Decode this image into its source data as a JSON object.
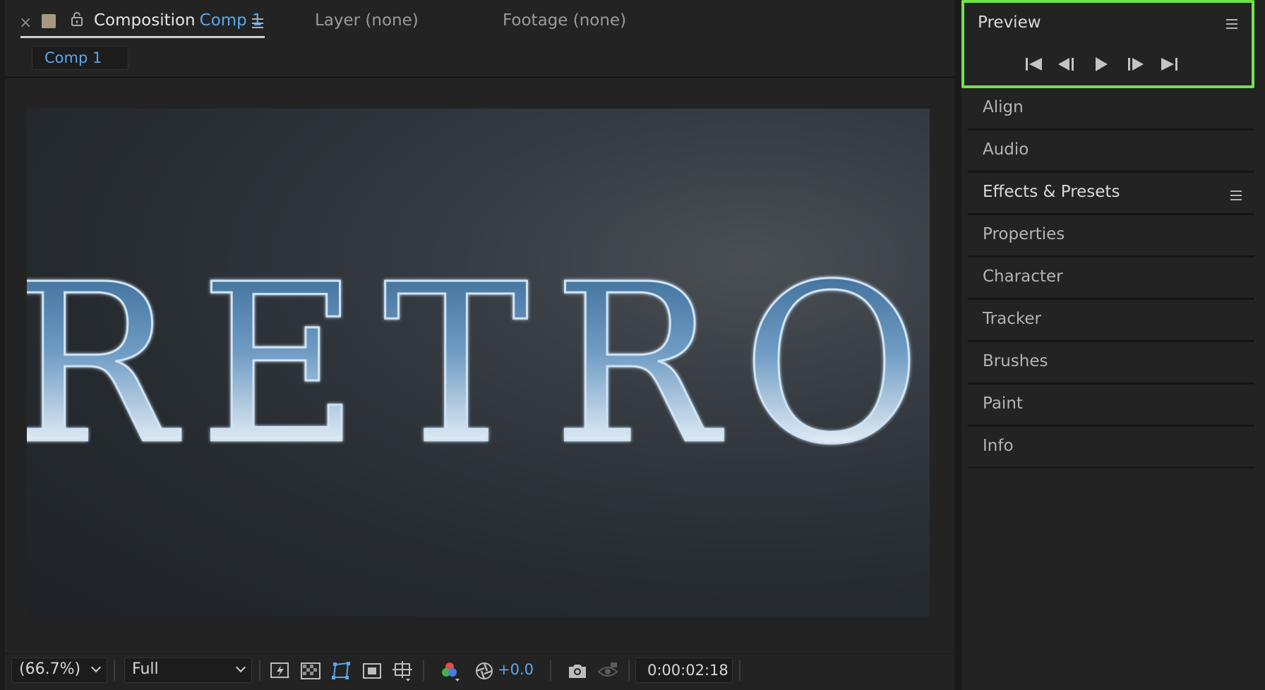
{
  "composition_panel": {
    "tabs": {
      "composition_label": "Composition",
      "composition_name": "Comp 1",
      "layer_label": "Layer (none)",
      "footage_label": "Footage (none)"
    },
    "breadcrumb": "Comp 1",
    "canvas_text": "RETRO",
    "toolbar": {
      "zoom": "(66.7%)",
      "resolution": "Full",
      "exposure": "+0.0",
      "timecode": "0:00:02:18"
    }
  },
  "right_panels": {
    "preview": {
      "title": "Preview",
      "controls": [
        "first-frame-icon",
        "previous-frame-icon",
        "play-icon",
        "next-frame-icon",
        "last-frame-icon"
      ]
    },
    "items": [
      {
        "label": "Align"
      },
      {
        "label": "Audio"
      },
      {
        "label": "Effects & Presets"
      },
      {
        "label": "Properties"
      },
      {
        "label": "Character"
      },
      {
        "label": "Tracker"
      },
      {
        "label": "Brushes"
      },
      {
        "label": "Paint"
      },
      {
        "label": "Info"
      }
    ]
  },
  "colors": {
    "accent_blue": "#5aa7ee",
    "highlight_green": "#6fe34a",
    "panel_bg": "#232323"
  }
}
